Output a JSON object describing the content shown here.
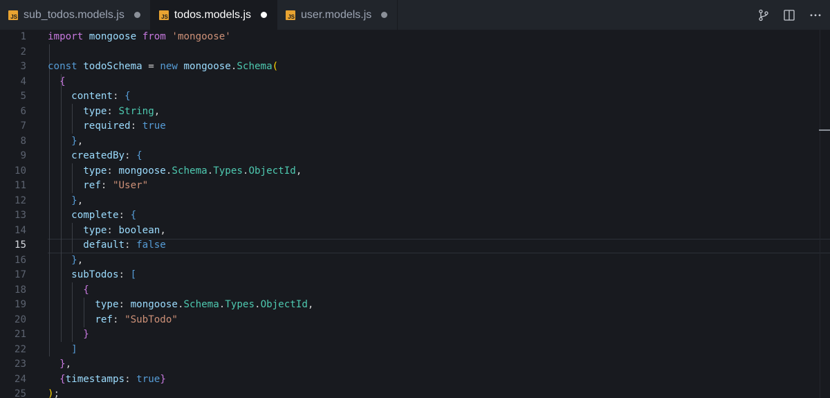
{
  "tabs": [
    {
      "icon": "js-file-icon",
      "icon_text": "JS",
      "label": "sub_todos.models.js",
      "active": false
    },
    {
      "icon": "js-file-icon",
      "icon_text": "JS",
      "label": "todos.models.js",
      "active": true
    },
    {
      "icon": "js-file-icon",
      "icon_text": "JS",
      "label": "user.models.js",
      "active": false
    }
  ],
  "actions": [
    "source-control-icon",
    "split-editor-icon",
    "more-actions-icon"
  ],
  "editor": {
    "current_line": 15,
    "lines": [
      {
        "n": "1",
        "tokens": [
          [
            "kw",
            "import"
          ],
          [
            "plain",
            " "
          ],
          [
            "var",
            "mongoose"
          ],
          [
            "plain",
            " "
          ],
          [
            "kw",
            "from"
          ],
          [
            "plain",
            " "
          ],
          [
            "str",
            "'mongoose'"
          ]
        ]
      },
      {
        "n": "2",
        "tokens": []
      },
      {
        "n": "3",
        "tokens": [
          [
            "kw2",
            "const"
          ],
          [
            "plain",
            " "
          ],
          [
            "var",
            "todoSchema"
          ],
          [
            "plain",
            " = "
          ],
          [
            "kw2",
            "new"
          ],
          [
            "plain",
            " "
          ],
          [
            "var",
            "mongoose"
          ],
          [
            "plain",
            "."
          ],
          [
            "cls",
            "Schema"
          ],
          [
            "brk",
            "("
          ]
        ]
      },
      {
        "n": "4",
        "tokens": [
          [
            "plain",
            "  "
          ],
          [
            "kw",
            "{"
          ]
        ]
      },
      {
        "n": "5",
        "tokens": [
          [
            "plain",
            "    "
          ],
          [
            "var",
            "content"
          ],
          [
            "plain",
            ": "
          ],
          [
            "kw2",
            "{"
          ]
        ]
      },
      {
        "n": "6",
        "tokens": [
          [
            "plain",
            "      "
          ],
          [
            "var",
            "type"
          ],
          [
            "plain",
            ": "
          ],
          [
            "cls",
            "String"
          ],
          [
            "plain",
            ","
          ]
        ]
      },
      {
        "n": "7",
        "tokens": [
          [
            "plain",
            "      "
          ],
          [
            "var",
            "required"
          ],
          [
            "plain",
            ": "
          ],
          [
            "kw2",
            "true"
          ]
        ]
      },
      {
        "n": "8",
        "tokens": [
          [
            "plain",
            "    "
          ],
          [
            "kw2",
            "}"
          ],
          [
            "plain",
            ","
          ]
        ]
      },
      {
        "n": "9",
        "tokens": [
          [
            "plain",
            "    "
          ],
          [
            "var",
            "createdBy"
          ],
          [
            "plain",
            ": "
          ],
          [
            "kw2",
            "{"
          ]
        ]
      },
      {
        "n": "10",
        "tokens": [
          [
            "plain",
            "      "
          ],
          [
            "var",
            "type"
          ],
          [
            "plain",
            ": "
          ],
          [
            "var",
            "mongoose"
          ],
          [
            "plain",
            "."
          ],
          [
            "cls",
            "Schema"
          ],
          [
            "plain",
            "."
          ],
          [
            "cls",
            "Types"
          ],
          [
            "plain",
            "."
          ],
          [
            "cls",
            "ObjectId"
          ],
          [
            "plain",
            ","
          ]
        ]
      },
      {
        "n": "11",
        "tokens": [
          [
            "plain",
            "      "
          ],
          [
            "var",
            "ref"
          ],
          [
            "plain",
            ": "
          ],
          [
            "str",
            "\"User\""
          ]
        ]
      },
      {
        "n": "12",
        "tokens": [
          [
            "plain",
            "    "
          ],
          [
            "kw2",
            "}"
          ],
          [
            "plain",
            ","
          ]
        ]
      },
      {
        "n": "13",
        "tokens": [
          [
            "plain",
            "    "
          ],
          [
            "var",
            "complete"
          ],
          [
            "plain",
            ": "
          ],
          [
            "kw2",
            "{"
          ]
        ]
      },
      {
        "n": "14",
        "tokens": [
          [
            "plain",
            "      "
          ],
          [
            "var",
            "type"
          ],
          [
            "plain",
            ": "
          ],
          [
            "var",
            "boolean"
          ],
          [
            "plain",
            ","
          ]
        ]
      },
      {
        "n": "15",
        "tokens": [
          [
            "plain",
            "      "
          ],
          [
            "var",
            "default"
          ],
          [
            "plain",
            ": "
          ],
          [
            "kw2",
            "false"
          ]
        ]
      },
      {
        "n": "16",
        "tokens": [
          [
            "plain",
            "    "
          ],
          [
            "kw2",
            "}"
          ],
          [
            "plain",
            ","
          ]
        ]
      },
      {
        "n": "17",
        "tokens": [
          [
            "plain",
            "    "
          ],
          [
            "var",
            "subTodos"
          ],
          [
            "plain",
            ": "
          ],
          [
            "kw2",
            "["
          ]
        ]
      },
      {
        "n": "18",
        "tokens": [
          [
            "plain",
            "      "
          ],
          [
            "kw",
            "{"
          ]
        ]
      },
      {
        "n": "19",
        "tokens": [
          [
            "plain",
            "        "
          ],
          [
            "var",
            "type"
          ],
          [
            "plain",
            ": "
          ],
          [
            "var",
            "mongoose"
          ],
          [
            "plain",
            "."
          ],
          [
            "cls",
            "Schema"
          ],
          [
            "plain",
            "."
          ],
          [
            "cls",
            "Types"
          ],
          [
            "plain",
            "."
          ],
          [
            "cls",
            "ObjectId"
          ],
          [
            "plain",
            ","
          ]
        ]
      },
      {
        "n": "20",
        "tokens": [
          [
            "plain",
            "        "
          ],
          [
            "var",
            "ref"
          ],
          [
            "plain",
            ": "
          ],
          [
            "str",
            "\"SubTodo\""
          ]
        ]
      },
      {
        "n": "21",
        "tokens": [
          [
            "plain",
            "      "
          ],
          [
            "kw",
            "}"
          ]
        ]
      },
      {
        "n": "22",
        "tokens": [
          [
            "plain",
            "    "
          ],
          [
            "kw2",
            "]"
          ]
        ]
      },
      {
        "n": "23",
        "tokens": [
          [
            "plain",
            "  "
          ],
          [
            "kw",
            "}"
          ],
          [
            "plain",
            ","
          ]
        ]
      },
      {
        "n": "24",
        "tokens": [
          [
            "plain",
            "  "
          ],
          [
            "kw",
            "{"
          ],
          [
            "var",
            "timestamps"
          ],
          [
            "plain",
            ": "
          ],
          [
            "kw2",
            "true"
          ],
          [
            "kw",
            "}"
          ]
        ]
      },
      {
        "n": "25",
        "tokens": [
          [
            "brk",
            ")"
          ],
          [
            "plain",
            ";"
          ]
        ]
      }
    ]
  }
}
